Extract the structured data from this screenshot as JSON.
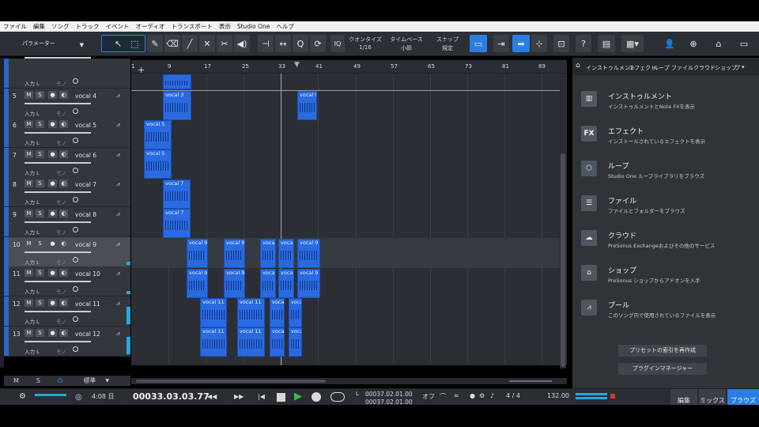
{
  "menu": [
    "ファイル",
    "編集",
    "ソング",
    "トラック",
    "イベント",
    "オーディオ",
    "トランスポート",
    "表示",
    "Studio One",
    "ヘルプ"
  ],
  "toolbar": {
    "parameter_label": "パラメーター",
    "quantize_label": "クオンタイズ",
    "quantize_value": "1/16",
    "timebase_label": "タイムベース",
    "timebase_value": "小節",
    "snap_label": "スナップ",
    "snap_value": "規定",
    "iq_label": "IQ",
    "help_label": "?"
  },
  "ruler": {
    "ticks": [
      "1",
      "9",
      "17",
      "25",
      "33",
      "41",
      "49",
      "57",
      "65",
      "73",
      "81",
      "89"
    ]
  },
  "tracks": [
    {
      "num": "",
      "name": "",
      "input": "入力 L",
      "mono": "モノ"
    },
    {
      "num": "5",
      "name": "vocal 4",
      "input": "入力 L",
      "mono": "モノ"
    },
    {
      "num": "6",
      "name": "vocal 5",
      "input": "入力 L",
      "mono": "モノ"
    },
    {
      "num": "7",
      "name": "vocal 6",
      "input": "入力 L",
      "mono": "モノ"
    },
    {
      "num": "8",
      "name": "vocal 7",
      "input": "入力 L",
      "mono": "モノ"
    },
    {
      "num": "9",
      "name": "vocal 8",
      "input": "入力 L",
      "mono": "モノ"
    },
    {
      "num": "10",
      "name": "vocal 9",
      "input": "入力 L",
      "mono": "モノ"
    },
    {
      "num": "11",
      "name": "vocal 10",
      "input": "入力 L",
      "mono": "モノ"
    },
    {
      "num": "12",
      "name": "vocal 11",
      "input": "入力 L",
      "mono": "モノ"
    },
    {
      "num": "13",
      "name": "vocal 12",
      "input": "入力 L",
      "mono": "モノ"
    }
  ],
  "clips": {
    "c0": "",
    "c1": "vocal 3",
    "c2": "vocal 9",
    "c3": "vocal 5",
    "c4": "vocal 5",
    "c5": "vocal 7",
    "c6": "vocal 7",
    "c7": "vocal 9",
    "c8": "vocal 9",
    "c9": "vocal 9",
    "c10": "vocal 9",
    "c11": "vocal 9",
    "c12": "vocal 9",
    "c13": "vocal 9",
    "c14": "vocal 9",
    "c15": "vocal 9",
    "c16": "vocal 9",
    "c17": "vocal 11",
    "c18": "vocal 11",
    "c19": "vocal 11",
    "c20": "voca",
    "c21": "vocal 11",
    "c22": "vocal 11",
    "c23": "vocal 11",
    "c24": "voca"
  },
  "track_footer": {
    "m": "M",
    "s": "S",
    "preset": "標準"
  },
  "browser": {
    "tabs": [
      "インストゥルメント",
      "エフェクト",
      "ループ",
      "ファイル",
      "クラウド",
      "ショップ",
      "プ"
    ],
    "items": [
      {
        "icon": "piano-icon",
        "title": "インストゥルメント",
        "desc": "インストゥルメントとNote FXを表示"
      },
      {
        "icon": "fx-icon",
        "title": "エフェクト",
        "desc": "インストールされているエフェクトを表示"
      },
      {
        "icon": "loop-icon",
        "title": "ループ",
        "desc": "Studio One ループライブラリをブラウズ"
      },
      {
        "icon": "file-icon",
        "title": "ファイル",
        "desc": "ファイルとフォルダーをブラウズ"
      },
      {
        "icon": "cloud-icon",
        "title": "クラウド",
        "desc": "PreSonus Exchangeおよびその他のサービス"
      },
      {
        "icon": "shop-icon",
        "title": "ショップ",
        "desc": "PreSonus ショップからアドオンを入手"
      },
      {
        "icon": "pool-icon",
        "title": "プール",
        "desc": "このソング内で使用されているファイルを表示"
      }
    ],
    "reindex_button": "プリセットの索引を再作成",
    "plugin_manager_button": "プラグインマネージャー"
  },
  "transport": {
    "time_small": "4:08 日",
    "position": "00033.03.03.77",
    "loop_start": "00037.02.01.00",
    "loop_end": "00037.02.01.00",
    "off_label": "オフ",
    "signature": "4 / 4",
    "tempo": "132.00"
  },
  "view_tabs": {
    "edit": "編集",
    "mix": "ミックス",
    "browse": "ブラウズ"
  },
  "colors": {
    "accent": "#2a7de1",
    "clip": "#2a6ae0",
    "meter": "#2aa7e0"
  }
}
